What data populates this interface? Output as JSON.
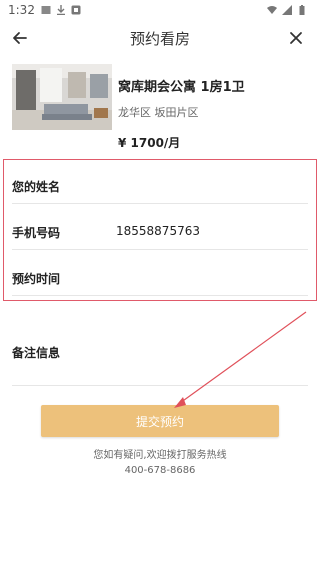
{
  "status_bar": {
    "time": "1:32"
  },
  "header": {
    "title": "预约看房"
  },
  "listing": {
    "name": "窝库期会公寓 1房1卫",
    "area": "龙华区 坂田片区",
    "price": "¥ 1700/月"
  },
  "form": {
    "name_label": "您的姓名",
    "name_value": "",
    "phone_label": "手机号码",
    "phone_value": "18558875763",
    "time_label": "预约时间",
    "time_value": "",
    "remarks_label": "备注信息",
    "remarks_value": ""
  },
  "submit_label": "提交预约",
  "help": {
    "line1": "您如有疑问,欢迎拨打服务热线",
    "phone": "400-678-8686"
  },
  "colors": {
    "submit_bg": "#edc17b",
    "highlight_border": "#e05a6a",
    "annotation_arrow": "#e0505a"
  }
}
